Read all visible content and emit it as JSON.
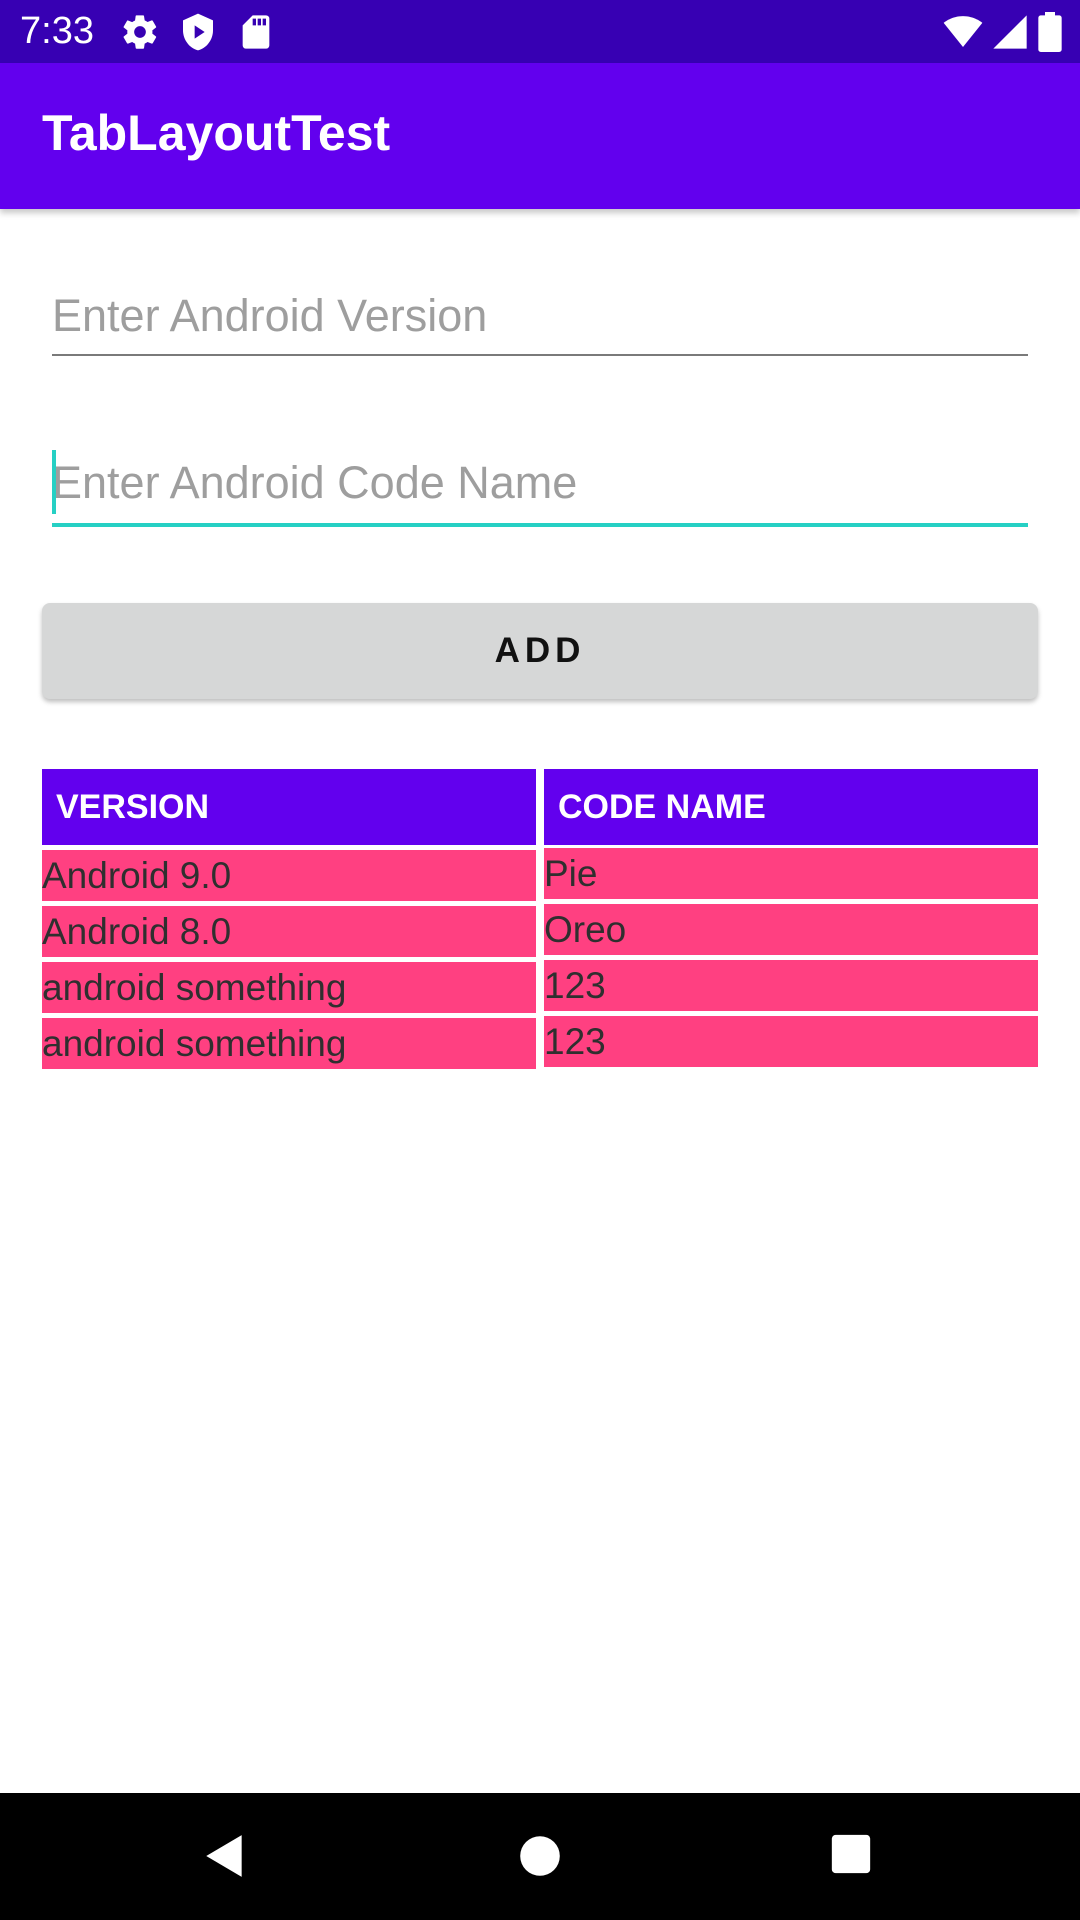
{
  "status_bar": {
    "time": "7:33",
    "left_icons": [
      "gear-icon",
      "shield-icon",
      "sd-card-icon"
    ],
    "right_icons": [
      "wifi-icon",
      "cell-signal-icon",
      "battery-icon"
    ],
    "bg_color": "#3700b3"
  },
  "app_bar": {
    "title": "TabLayoutTest",
    "bg_color": "#6200ee"
  },
  "form": {
    "version_field": {
      "value": "",
      "placeholder": "Enter Android Version"
    },
    "code_name_field": {
      "value": "",
      "placeholder": "Enter Android Code Name",
      "focused": true
    },
    "accent_color": "#26d0c4",
    "add_button_label": "ADD"
  },
  "table": {
    "headers": [
      "VERSION",
      "CODE NAME"
    ],
    "header_color": "#6200ee",
    "row_color": "#ff4081",
    "rows": [
      [
        "Android 9.0",
        "Pie"
      ],
      [
        "Android 8.0",
        "Oreo"
      ],
      [
        "android something",
        "123"
      ],
      [
        "android something",
        "123"
      ]
    ]
  },
  "nav_bar": {
    "buttons": [
      "back-icon",
      "home-icon",
      "recents-icon"
    ]
  }
}
